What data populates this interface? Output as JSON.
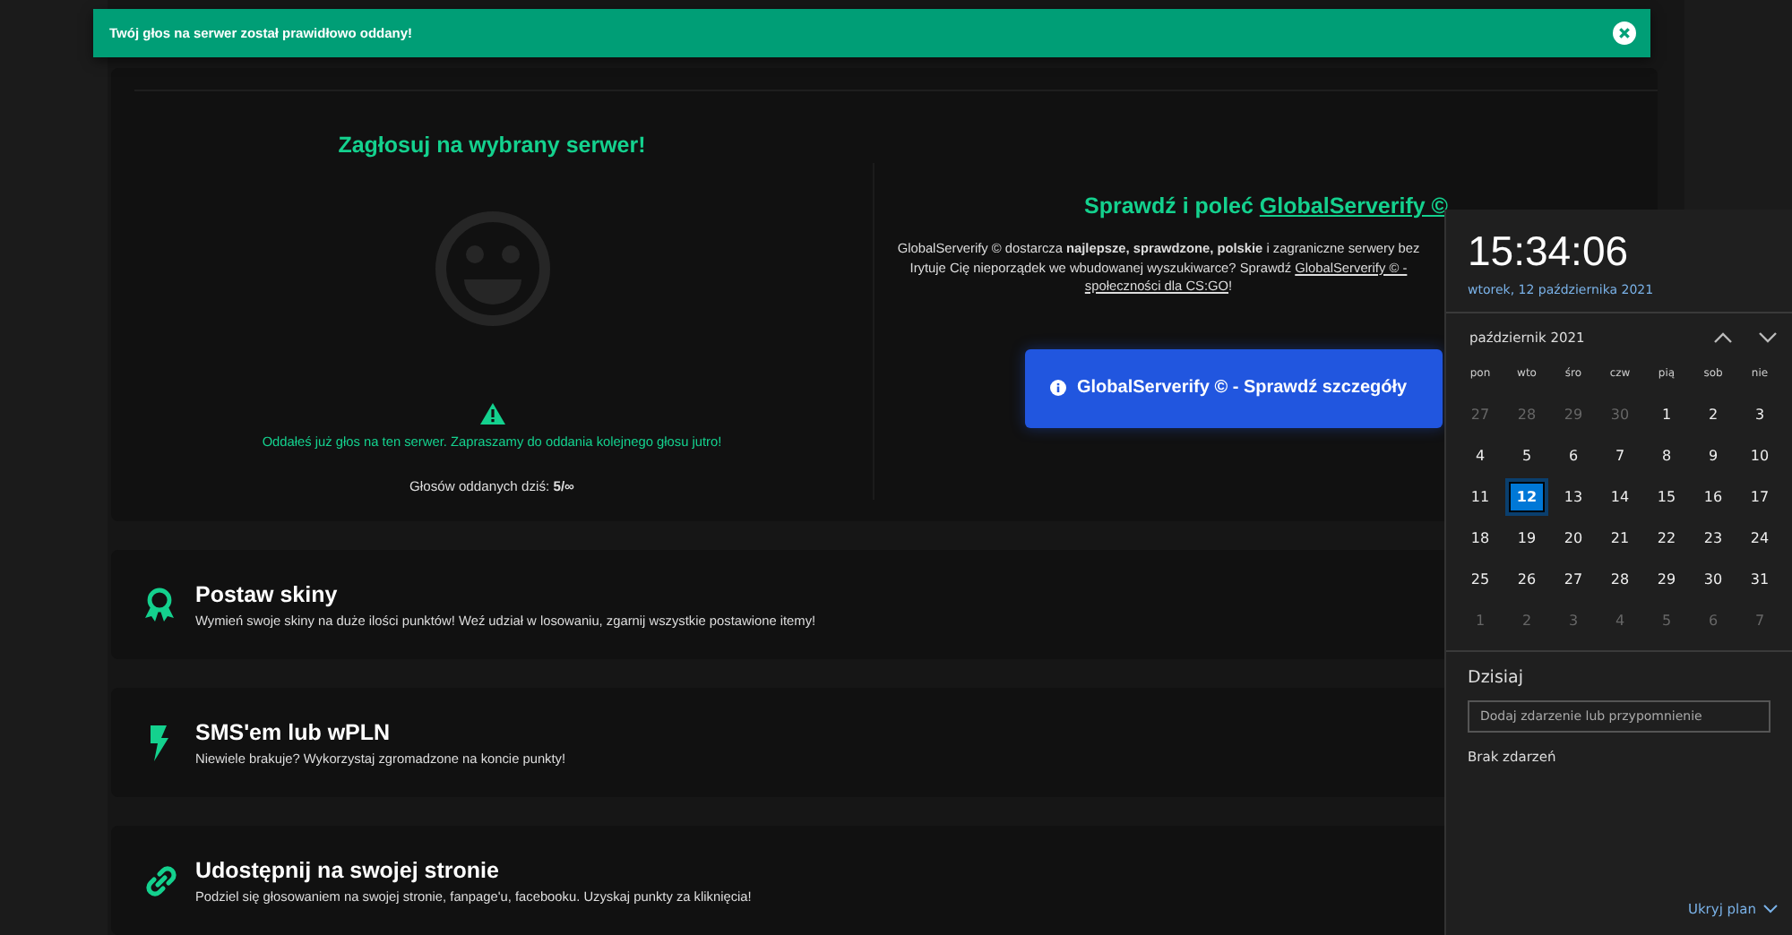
{
  "toast": {
    "message": "Twój głos na serwer został prawidłowo oddany!"
  },
  "vote": {
    "title": "Zagłosuj na wybrany serwer!",
    "notice": "Oddałeś już głos na ten serwer. Zapraszamy do oddania kolejnego głosu jutro!",
    "votes_today": "Głosów oddanych dziś: **5/∞**"
  },
  "promo": {
    "heading": "Sprawdź i poleć",
    "heading_link": "GlobalServerify ©",
    "lines": [
      [
        {
          "text": "GlobalServerify © dostarcza **najlepsze, sprawdzone, polskie** i zagraniczne serwery bez"
        }
      ],
      [
        {
          "text": "Irytuje Cię nieporządek we wbudowanej wyszukiwarce? Sprawdź "
        },
        {
          "link": "GlobalServerify © -"
        }
      ],
      [
        {
          "link": "społeczności dla CS:GO"
        },
        {
          "text": "!"
        }
      ]
    ],
    "button": "GlobalServerify © - Sprawdź szczegóły"
  },
  "features": [
    {
      "kind": "award",
      "title": "Postaw skiny",
      "description": "Wymień swoje skiny na duże ilości punktów! Weź udział w losowaniu, zgarnij wszystkie postawione itemy!"
    },
    {
      "kind": "bolt",
      "title": "SMS'em lub wPLN",
      "description": "Niewiele brakuje? Wykorzystaj zgromadzone na koncie punkty!"
    },
    {
      "kind": "link",
      "title": "Udostępnij na swojej stronie",
      "description": "Podziel się głosowaniem na swojej stronie, fanpage'u, facebooku. Uzyskaj punkty za kliknięcia!"
    }
  ],
  "calendar": {
    "time": "15:34:06",
    "date": "wtorek, 12 października 2021",
    "month": "październik 2021",
    "weekdays": [
      "pon",
      "wto",
      "śro",
      "czw",
      "pią",
      "sob",
      "nie"
    ],
    "weeks": [
      [
        {
          "day": "27",
          "muted": true,
          "selected": false
        },
        {
          "day": "28",
          "muted": true,
          "selected": false
        },
        {
          "day": "29",
          "muted": true,
          "selected": false
        },
        {
          "day": "30",
          "muted": true,
          "selected": false
        },
        {
          "day": "1",
          "muted": false,
          "selected": false
        },
        {
          "day": "2",
          "muted": false,
          "selected": false
        },
        {
          "day": "3",
          "muted": false,
          "selected": false
        }
      ],
      [
        {
          "day": "4",
          "muted": false,
          "selected": false
        },
        {
          "day": "5",
          "muted": false,
          "selected": false
        },
        {
          "day": "6",
          "muted": false,
          "selected": false
        },
        {
          "day": "7",
          "muted": false,
          "selected": false
        },
        {
          "day": "8",
          "muted": false,
          "selected": false
        },
        {
          "day": "9",
          "muted": false,
          "selected": false
        },
        {
          "day": "10",
          "muted": false,
          "selected": false
        }
      ],
      [
        {
          "day": "11",
          "muted": false,
          "selected": false
        },
        {
          "day": "12",
          "muted": false,
          "selected": true
        },
        {
          "day": "13",
          "muted": false,
          "selected": false
        },
        {
          "day": "14",
          "muted": false,
          "selected": false
        },
        {
          "day": "15",
          "muted": false,
          "selected": false
        },
        {
          "day": "16",
          "muted": false,
          "selected": false
        },
        {
          "day": "17",
          "muted": false,
          "selected": false
        }
      ],
      [
        {
          "day": "18",
          "muted": false,
          "selected": false
        },
        {
          "day": "19",
          "muted": false,
          "selected": false
        },
        {
          "day": "20",
          "muted": false,
          "selected": false
        },
        {
          "day": "21",
          "muted": false,
          "selected": false
        },
        {
          "day": "22",
          "muted": false,
          "selected": false
        },
        {
          "day": "23",
          "muted": false,
          "selected": false
        },
        {
          "day": "24",
          "muted": false,
          "selected": false
        }
      ],
      [
        {
          "day": "25",
          "muted": false,
          "selected": false
        },
        {
          "day": "26",
          "muted": false,
          "selected": false
        },
        {
          "day": "27",
          "muted": false,
          "selected": false
        },
        {
          "day": "28",
          "muted": false,
          "selected": false
        },
        {
          "day": "29",
          "muted": false,
          "selected": false
        },
        {
          "day": "30",
          "muted": false,
          "selected": false
        },
        {
          "day": "31",
          "muted": false,
          "selected": false
        }
      ],
      [
        {
          "day": "1",
          "muted": true,
          "selected": false
        },
        {
          "day": "2",
          "muted": true,
          "selected": false
        },
        {
          "day": "3",
          "muted": true,
          "selected": false
        },
        {
          "day": "4",
          "muted": true,
          "selected": false
        },
        {
          "day": "5",
          "muted": true,
          "selected": false
        },
        {
          "day": "6",
          "muted": true,
          "selected": false
        },
        {
          "day": "7",
          "muted": true,
          "selected": false
        }
      ]
    ],
    "today_label": "Dzisiaj",
    "event_placeholder": "Dodaj zdarzenie lub przypomnienie",
    "no_events": "Brak zdarzeń",
    "hide_plan": "Ukryj plan"
  }
}
